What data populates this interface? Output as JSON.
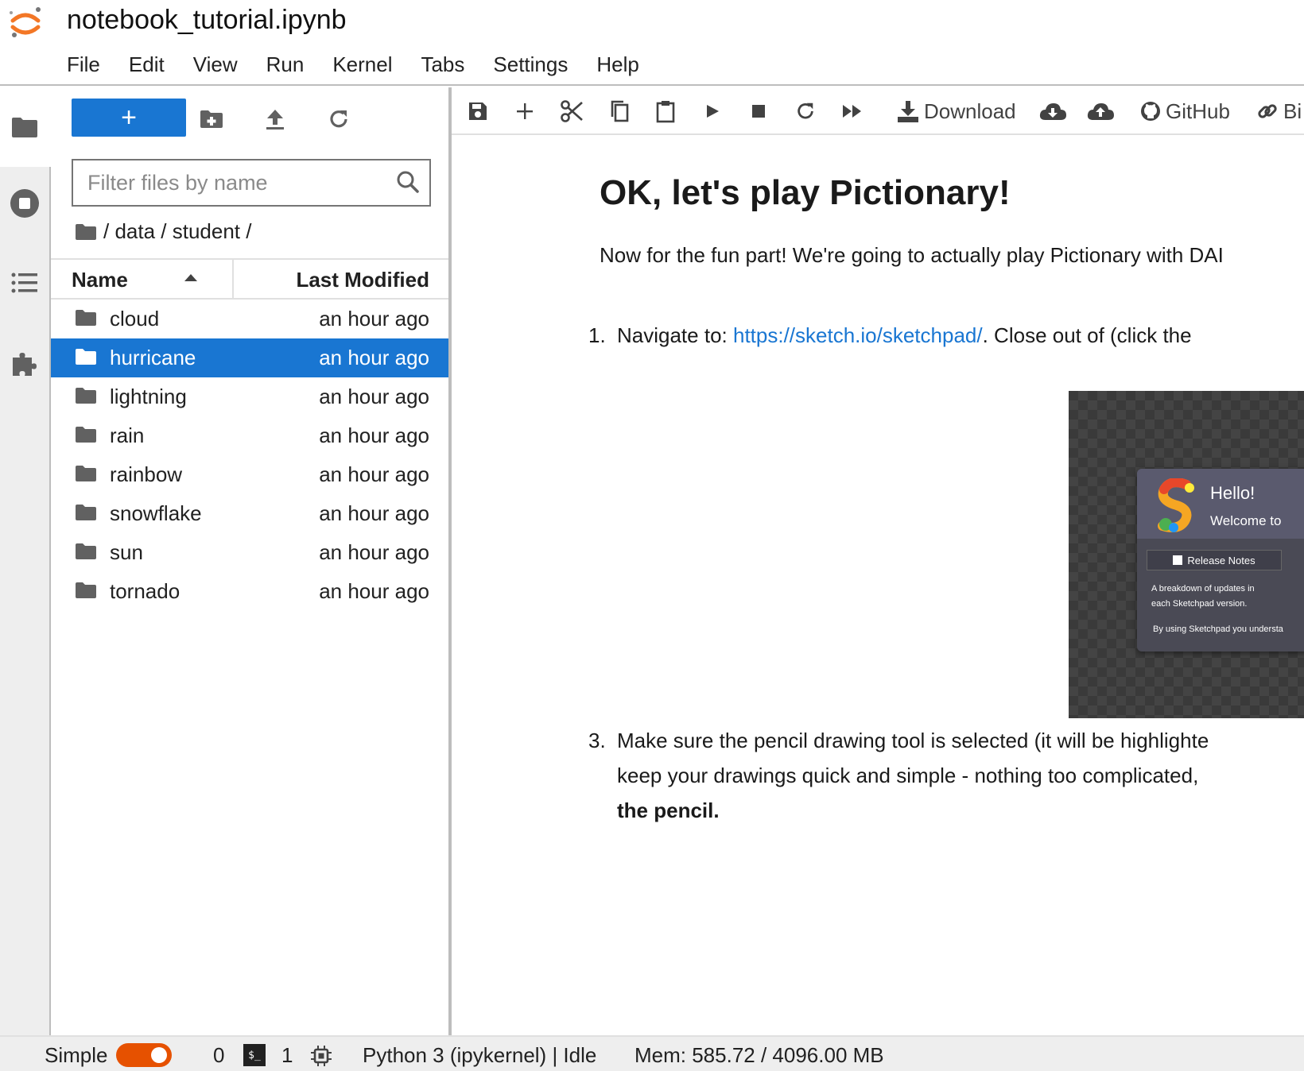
{
  "header": {
    "title": "notebook_tutorial.ipynb",
    "menu": [
      "File",
      "Edit",
      "View",
      "Run",
      "Kernel",
      "Tabs",
      "Settings",
      "Help"
    ]
  },
  "activity_bar": {
    "icons": [
      "folder-icon",
      "stop-circle-icon",
      "list-icon",
      "puzzle-icon"
    ]
  },
  "file_browser": {
    "new_label": "+",
    "filter_placeholder": "Filter files by name",
    "breadcrumb": "/ data / student /",
    "columns": {
      "name": "Name",
      "modified": "Last Modified"
    },
    "files": [
      {
        "name": "cloud",
        "modified": "an hour ago",
        "selected": false
      },
      {
        "name": "hurricane",
        "modified": "an hour ago",
        "selected": true
      },
      {
        "name": "lightning",
        "modified": "an hour ago",
        "selected": false
      },
      {
        "name": "rain",
        "modified": "an hour ago",
        "selected": false
      },
      {
        "name": "rainbow",
        "modified": "an hour ago",
        "selected": false
      },
      {
        "name": "snowflake",
        "modified": "an hour ago",
        "selected": false
      },
      {
        "name": "sun",
        "modified": "an hour ago",
        "selected": false
      },
      {
        "name": "tornado",
        "modified": "an hour ago",
        "selected": false
      }
    ]
  },
  "notebook_toolbar": {
    "download_label": "Download",
    "github_label": "GitHub",
    "binder_label": "Bi"
  },
  "notebook": {
    "heading": "OK, let's play Pictionary!",
    "intro": "Now for the fun part! We're going to actually play Pictionary with DAI",
    "step1_num": "1.",
    "step1_prefix": "Navigate to: ",
    "step1_link": "https://sketch.io/sketchpad/",
    "step1_suffix": ". Close out of (click the",
    "step3_num": "3.",
    "step3_line1": "Make sure the pencil drawing tool is selected (it will be highlighte",
    "step3_line2": "keep your drawings quick and simple - nothing too complicated,",
    "step3_line3": "the pencil.",
    "screenshot": {
      "hello": "Hello!",
      "welcome": "Welcome to",
      "release_notes": "Release Notes",
      "desc_line1": "A breakdown of updates in",
      "desc_line2": "each Sketchpad version.",
      "terms": "By using Sketchpad you understa"
    }
  },
  "status_bar": {
    "mode_label": "Simple",
    "mode_enabled": true,
    "terminals_count": "0",
    "terminal_glyph": "$_",
    "kernels_count": "1",
    "kernel_status": "Python 3 (ipykernel) | Idle",
    "memory": "Mem: 585.72 / 4096.00 MB"
  },
  "colors": {
    "accent": "#1976d2",
    "toggle": "#e65100",
    "logo": "#f37726"
  }
}
